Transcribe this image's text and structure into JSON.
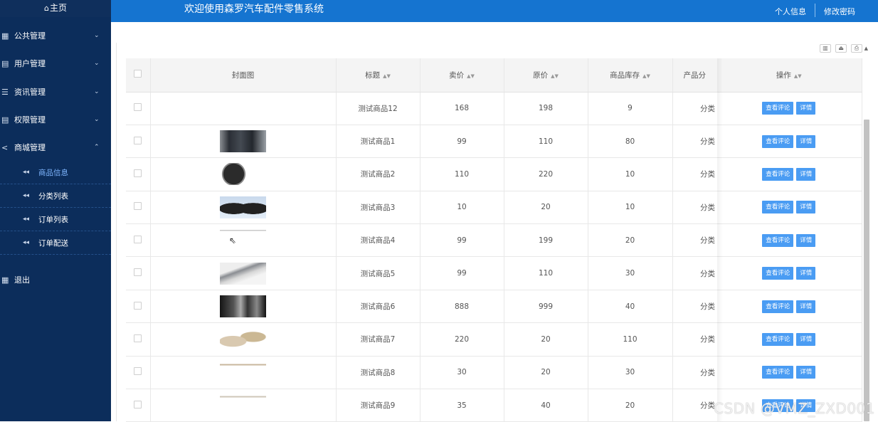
{
  "sidebar": {
    "home": "主页",
    "menus": [
      {
        "label": "公共管理",
        "icon": "grid-icon",
        "chev": "⌄"
      },
      {
        "label": "用户管理",
        "icon": "book-icon",
        "chev": "⌄"
      },
      {
        "label": "资讯管理",
        "icon": "list-icon",
        "chev": "⌄"
      },
      {
        "label": "权限管理",
        "icon": "book-icon",
        "chev": "⌄"
      },
      {
        "label": "商城管理",
        "icon": "share-icon",
        "chev": "⌃"
      }
    ],
    "subs": [
      {
        "label": "商品信息",
        "active": true
      },
      {
        "label": "分类列表"
      },
      {
        "label": "订单列表"
      },
      {
        "label": "订单配送"
      }
    ],
    "logout": "退出"
  },
  "header": {
    "title": "欢迎使用森罗汽车配件零售系统",
    "profile": "个人信息",
    "change_password": "修改密码"
  },
  "table": {
    "columns": [
      "封面图",
      "标题",
      "卖价",
      "原价",
      "商品库存",
      "产品分",
      "操作"
    ],
    "buttons": {
      "reviews": "查看评论",
      "detail": "详情"
    },
    "rows": [
      {
        "title": "测试商品12",
        "price": "168",
        "orig": "198",
        "stock": "9",
        "cat": "分类"
      },
      {
        "title": "测试商品1",
        "price": "99",
        "orig": "110",
        "stock": "80",
        "cat": "分类"
      },
      {
        "title": "测试商品2",
        "price": "110",
        "orig": "220",
        "stock": "10",
        "cat": "分类"
      },
      {
        "title": "测试商品3",
        "price": "10",
        "orig": "20",
        "stock": "10",
        "cat": "分类"
      },
      {
        "title": "测试商品4",
        "price": "99",
        "orig": "199",
        "stock": "20",
        "cat": "分类"
      },
      {
        "title": "测试商品5",
        "price": "99",
        "orig": "110",
        "stock": "30",
        "cat": "分类"
      },
      {
        "title": "测试商品6",
        "price": "888",
        "orig": "999",
        "stock": "40",
        "cat": "分类"
      },
      {
        "title": "测试商品7",
        "price": "220",
        "orig": "20",
        "stock": "110",
        "cat": "分类"
      },
      {
        "title": "测试商品8",
        "price": "30",
        "orig": "20",
        "stock": "30",
        "cat": "分类"
      },
      {
        "title": "测试商品9",
        "price": "35",
        "orig": "40",
        "stock": "20",
        "cat": "分类"
      }
    ]
  },
  "watermark": "CSDN @VMZ_ZXD001"
}
